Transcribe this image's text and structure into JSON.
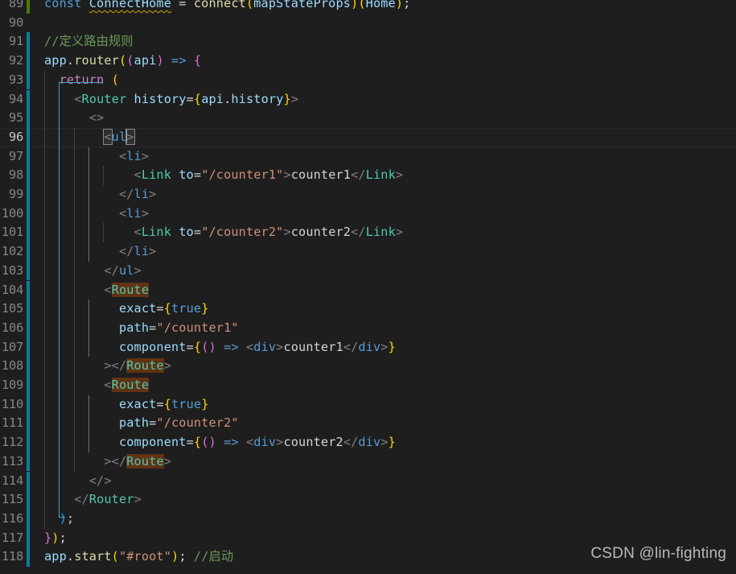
{
  "editor": {
    "theme": "dark-plus",
    "background_color": "#1e1e1e",
    "language": "javascriptreact",
    "first_visible_line": 89,
    "last_visible_line": 118,
    "cursor_line": 96,
    "cursor_column": 10,
    "find_match_term": "Route",
    "find_match_highlight_color": "#613214",
    "git_modified_color": "#0c7d9d",
    "git_added_color": "#487e02",
    "active_indent_guide_color": "#707070",
    "bracket_pair_guide_color": "#4f9dc4"
  },
  "watermark": {
    "text": "CSDN @lin-fighting"
  },
  "lines": [
    {
      "number": "89",
      "git": "add",
      "clipped_top": true,
      "text": "const ConnectHome = connect(mapStateProps)(Home);",
      "tokens": [
        {
          "t": "const ",
          "c": "t-kw2"
        },
        {
          "t": "ConnectHome",
          "c": "t-var squiggle"
        },
        {
          "t": " = ",
          "c": "t-plain"
        },
        {
          "t": "connect",
          "c": "t-fn"
        },
        {
          "t": "(",
          "c": "t-p-y"
        },
        {
          "t": "mapStateProps",
          "c": "t-var"
        },
        {
          "t": ")",
          "c": "t-p-y"
        },
        {
          "t": "(",
          "c": "t-p-y"
        },
        {
          "t": "Home",
          "c": "t-var"
        },
        {
          "t": ")",
          "c": "t-p-y"
        },
        {
          "t": ";",
          "c": "t-plain"
        }
      ]
    },
    {
      "number": "90",
      "git": "none",
      "text": "",
      "tokens": []
    },
    {
      "number": "91",
      "git": "mod",
      "text": "//定义路由规则",
      "tokens": [
        {
          "t": "//定义路由规则",
          "c": "t-comment"
        }
      ]
    },
    {
      "number": "92",
      "git": "mod",
      "text": "app.router((api) => {",
      "tokens": [
        {
          "t": "app",
          "c": "t-var"
        },
        {
          "t": ".",
          "c": "t-plain"
        },
        {
          "t": "router",
          "c": "t-fn"
        },
        {
          "t": "(",
          "c": "t-p-y"
        },
        {
          "t": "(",
          "c": "t-p-m"
        },
        {
          "t": "api",
          "c": "t-var"
        },
        {
          "t": ")",
          "c": "t-p-m"
        },
        {
          "t": " ",
          "c": "t-plain"
        },
        {
          "t": "=>",
          "c": "t-kw2"
        },
        {
          "t": " ",
          "c": "t-plain"
        },
        {
          "t": "{",
          "c": "t-p-m"
        }
      ]
    },
    {
      "number": "93",
      "git": "mod",
      "indent": 1,
      "text": "  return (",
      "tokens": [
        {
          "t": "  ",
          "c": "t-plain"
        },
        {
          "t": "return",
          "c": "t-kw"
        },
        {
          "t": " ",
          "c": "t-plain"
        },
        {
          "t": "(",
          "c": "t-p-y"
        }
      ]
    },
    {
      "number": "94",
      "git": "mod",
      "indent": 1,
      "text": "    <Router history={api.history}>",
      "tokens": [
        {
          "t": "    ",
          "c": "t-plain"
        },
        {
          "t": "<",
          "c": "t-tagb"
        },
        {
          "t": "Router",
          "c": "t-type"
        },
        {
          "t": " ",
          "c": "t-plain"
        },
        {
          "t": "history",
          "c": "t-var"
        },
        {
          "t": "=",
          "c": "t-plain"
        },
        {
          "t": "{",
          "c": "t-p-y"
        },
        {
          "t": "api",
          "c": "t-var"
        },
        {
          "t": ".",
          "c": "t-plain"
        },
        {
          "t": "history",
          "c": "t-var"
        },
        {
          "t": "}",
          "c": "t-p-y"
        },
        {
          "t": ">",
          "c": "t-tagb"
        }
      ]
    },
    {
      "number": "95",
      "git": "mod",
      "indent": 2,
      "text": "      <>",
      "tokens": [
        {
          "t": "      ",
          "c": "t-plain"
        },
        {
          "t": "<>",
          "c": "t-tagb"
        }
      ]
    },
    {
      "number": "96",
      "git": "mod",
      "current": true,
      "indent": 3,
      "text": "        <ul>",
      "tokens": [
        {
          "t": "        ",
          "c": "t-plain"
        },
        {
          "t": "<",
          "c": "t-tagb bmatch"
        },
        {
          "t": "ul",
          "c": "t-kw2"
        },
        {
          "t": "CARET",
          "c": "caret"
        },
        {
          "t": ">",
          "c": "t-tagb bmatch"
        }
      ]
    },
    {
      "number": "97",
      "git": "mod",
      "indent": 4,
      "text": "          <li>",
      "tokens": [
        {
          "t": "          ",
          "c": "t-plain"
        },
        {
          "t": "<",
          "c": "t-tagb"
        },
        {
          "t": "li",
          "c": "t-kw2"
        },
        {
          "t": ">",
          "c": "t-tagb"
        }
      ]
    },
    {
      "number": "98",
      "git": "mod",
      "indent": 5,
      "text": "            <Link to=\"/counter1\">counter1</Link>",
      "tokens": [
        {
          "t": "            ",
          "c": "t-plain"
        },
        {
          "t": "<",
          "c": "t-tagb"
        },
        {
          "t": "Link",
          "c": "t-type"
        },
        {
          "t": " ",
          "c": "t-plain"
        },
        {
          "t": "to",
          "c": "t-var"
        },
        {
          "t": "=",
          "c": "t-plain"
        },
        {
          "t": "\"/counter1\"",
          "c": "t-str"
        },
        {
          "t": ">",
          "c": "t-tagb"
        },
        {
          "t": "counter1",
          "c": "t-plain"
        },
        {
          "t": "</",
          "c": "t-tagb"
        },
        {
          "t": "Link",
          "c": "t-type"
        },
        {
          "t": ">",
          "c": "t-tagb"
        }
      ]
    },
    {
      "number": "99",
      "git": "mod",
      "indent": 4,
      "text": "          </li>",
      "tokens": [
        {
          "t": "          ",
          "c": "t-plain"
        },
        {
          "t": "</",
          "c": "t-tagb"
        },
        {
          "t": "li",
          "c": "t-kw2"
        },
        {
          "t": ">",
          "c": "t-tagb"
        }
      ]
    },
    {
      "number": "100",
      "git": "mod",
      "indent": 4,
      "text": "          <li>",
      "tokens": [
        {
          "t": "          ",
          "c": "t-plain"
        },
        {
          "t": "<",
          "c": "t-tagb"
        },
        {
          "t": "li",
          "c": "t-kw2"
        },
        {
          "t": ">",
          "c": "t-tagb"
        }
      ]
    },
    {
      "number": "101",
      "git": "mod",
      "indent": 5,
      "text": "            <Link to=\"/counter2\">counter2</Link>",
      "tokens": [
        {
          "t": "            ",
          "c": "t-plain"
        },
        {
          "t": "<",
          "c": "t-tagb"
        },
        {
          "t": "Link",
          "c": "t-type"
        },
        {
          "t": " ",
          "c": "t-plain"
        },
        {
          "t": "to",
          "c": "t-var"
        },
        {
          "t": "=",
          "c": "t-plain"
        },
        {
          "t": "\"/counter2\"",
          "c": "t-str"
        },
        {
          "t": ">",
          "c": "t-tagb"
        },
        {
          "t": "counter2",
          "c": "t-plain"
        },
        {
          "t": "</",
          "c": "t-tagb"
        },
        {
          "t": "Link",
          "c": "t-type"
        },
        {
          "t": ">",
          "c": "t-tagb"
        }
      ]
    },
    {
      "number": "102",
      "git": "mod",
      "indent": 4,
      "text": "          </li>",
      "tokens": [
        {
          "t": "          ",
          "c": "t-plain"
        },
        {
          "t": "</",
          "c": "t-tagb"
        },
        {
          "t": "li",
          "c": "t-kw2"
        },
        {
          "t": ">",
          "c": "t-tagb"
        }
      ]
    },
    {
      "number": "103",
      "git": "mod",
      "indent": 3,
      "text": "        </ul>",
      "tokens": [
        {
          "t": "        ",
          "c": "t-plain"
        },
        {
          "t": "</",
          "c": "t-tagb"
        },
        {
          "t": "ul",
          "c": "t-kw2"
        },
        {
          "t": ">",
          "c": "t-tagb"
        }
      ]
    },
    {
      "number": "104",
      "git": "mod",
      "indent": 3,
      "text": "        <Route",
      "tokens": [
        {
          "t": "        ",
          "c": "t-plain"
        },
        {
          "t": "<",
          "c": "t-tagb"
        },
        {
          "t": "Route",
          "c": "t-type hl"
        }
      ]
    },
    {
      "number": "105",
      "git": "mod",
      "indent": 4,
      "text": "          exact={true}",
      "tokens": [
        {
          "t": "          ",
          "c": "t-plain"
        },
        {
          "t": "exact",
          "c": "t-var"
        },
        {
          "t": "=",
          "c": "t-plain"
        },
        {
          "t": "{",
          "c": "t-p-y"
        },
        {
          "t": "true",
          "c": "t-kw2"
        },
        {
          "t": "}",
          "c": "t-p-y"
        }
      ]
    },
    {
      "number": "106",
      "git": "mod",
      "indent": 4,
      "text": "          path=\"/counter1\"",
      "tokens": [
        {
          "t": "          ",
          "c": "t-plain"
        },
        {
          "t": "path",
          "c": "t-var"
        },
        {
          "t": "=",
          "c": "t-plain"
        },
        {
          "t": "\"/counter1\"",
          "c": "t-str"
        }
      ]
    },
    {
      "number": "107",
      "git": "mod",
      "indent": 4,
      "text": "          component={() => <div>counter1</div>}",
      "tokens": [
        {
          "t": "          ",
          "c": "t-plain"
        },
        {
          "t": "component",
          "c": "t-var"
        },
        {
          "t": "=",
          "c": "t-plain"
        },
        {
          "t": "{",
          "c": "t-p-y"
        },
        {
          "t": "(",
          "c": "t-p-m"
        },
        {
          "t": ")",
          "c": "t-p-m"
        },
        {
          "t": " ",
          "c": "t-plain"
        },
        {
          "t": "=>",
          "c": "t-kw2"
        },
        {
          "t": " ",
          "c": "t-plain"
        },
        {
          "t": "<",
          "c": "t-tagb"
        },
        {
          "t": "div",
          "c": "t-kw2"
        },
        {
          "t": ">",
          "c": "t-tagb"
        },
        {
          "t": "counter1",
          "c": "t-plain"
        },
        {
          "t": "</",
          "c": "t-tagb"
        },
        {
          "t": "div",
          "c": "t-kw2"
        },
        {
          "t": ">",
          "c": "t-tagb"
        },
        {
          "t": "}",
          "c": "t-p-y"
        }
      ]
    },
    {
      "number": "108",
      "git": "mod",
      "indent": 3,
      "text": "        ></Route>",
      "tokens": [
        {
          "t": "        ",
          "c": "t-plain"
        },
        {
          "t": "></",
          "c": "t-tagb"
        },
        {
          "t": "Route",
          "c": "t-type hl"
        },
        {
          "t": ">",
          "c": "t-tagb"
        }
      ]
    },
    {
      "number": "109",
      "git": "mod",
      "indent": 3,
      "text": "        <Route",
      "tokens": [
        {
          "t": "        ",
          "c": "t-plain"
        },
        {
          "t": "<",
          "c": "t-tagb"
        },
        {
          "t": "Route",
          "c": "t-type hl"
        }
      ]
    },
    {
      "number": "110",
      "git": "mod",
      "indent": 4,
      "text": "          exact={true}",
      "tokens": [
        {
          "t": "          ",
          "c": "t-plain"
        },
        {
          "t": "exact",
          "c": "t-var"
        },
        {
          "t": "=",
          "c": "t-plain"
        },
        {
          "t": "{",
          "c": "t-p-y"
        },
        {
          "t": "true",
          "c": "t-kw2"
        },
        {
          "t": "}",
          "c": "t-p-y"
        }
      ]
    },
    {
      "number": "111",
      "git": "mod",
      "indent": 4,
      "text": "          path=\"/counter2\"",
      "tokens": [
        {
          "t": "          ",
          "c": "t-plain"
        },
        {
          "t": "path",
          "c": "t-var"
        },
        {
          "t": "=",
          "c": "t-plain"
        },
        {
          "t": "\"/counter2\"",
          "c": "t-str"
        }
      ]
    },
    {
      "number": "112",
      "git": "mod",
      "indent": 4,
      "text": "          component={() => <div>counter2</div>}",
      "tokens": [
        {
          "t": "          ",
          "c": "t-plain"
        },
        {
          "t": "component",
          "c": "t-var"
        },
        {
          "t": "=",
          "c": "t-plain"
        },
        {
          "t": "{",
          "c": "t-p-y"
        },
        {
          "t": "(",
          "c": "t-p-m"
        },
        {
          "t": ")",
          "c": "t-p-m"
        },
        {
          "t": " ",
          "c": "t-plain"
        },
        {
          "t": "=>",
          "c": "t-kw2"
        },
        {
          "t": " ",
          "c": "t-plain"
        },
        {
          "t": "<",
          "c": "t-tagb"
        },
        {
          "t": "div",
          "c": "t-kw2"
        },
        {
          "t": ">",
          "c": "t-tagb"
        },
        {
          "t": "counter2",
          "c": "t-plain"
        },
        {
          "t": "</",
          "c": "t-tagb"
        },
        {
          "t": "div",
          "c": "t-kw2"
        },
        {
          "t": ">",
          "c": "t-tagb"
        },
        {
          "t": "}",
          "c": "t-p-y"
        }
      ]
    },
    {
      "number": "113",
      "git": "mod",
      "indent": 3,
      "text": "        ></Route>",
      "tokens": [
        {
          "t": "        ",
          "c": "t-plain"
        },
        {
          "t": "></",
          "c": "t-tagb"
        },
        {
          "t": "Route",
          "c": "t-type hl"
        },
        {
          "t": ">",
          "c": "t-tagb"
        }
      ]
    },
    {
      "number": "114",
      "git": "mod",
      "indent": 2,
      "text": "      </>",
      "tokens": [
        {
          "t": "      ",
          "c": "t-plain"
        },
        {
          "t": "</>",
          "c": "t-tagb"
        }
      ]
    },
    {
      "number": "115",
      "git": "mod",
      "indent": 1,
      "text": "    </Router>",
      "tokens": [
        {
          "t": "    ",
          "c": "t-plain"
        },
        {
          "t": "</",
          "c": "t-tagb"
        },
        {
          "t": "Router",
          "c": "t-type"
        },
        {
          "t": ">",
          "c": "t-tagb"
        }
      ]
    },
    {
      "number": "116",
      "git": "mod",
      "indent": 1,
      "text": "  );",
      "tokens": [
        {
          "t": "  ",
          "c": "t-plain"
        },
        {
          "t": ")",
          "c": "t-p-b"
        },
        {
          "t": ";",
          "c": "t-plain"
        }
      ]
    },
    {
      "number": "117",
      "git": "mod",
      "text": "});",
      "tokens": [
        {
          "t": "}",
          "c": "t-p-m"
        },
        {
          "t": ")",
          "c": "t-p-y"
        },
        {
          "t": ";",
          "c": "t-plain"
        }
      ]
    },
    {
      "number": "118",
      "git": "mod",
      "text": "app.start(\"#root\"); //启动",
      "tokens": [
        {
          "t": "app",
          "c": "t-var"
        },
        {
          "t": ".",
          "c": "t-plain"
        },
        {
          "t": "start",
          "c": "t-fn"
        },
        {
          "t": "(",
          "c": "t-p-y"
        },
        {
          "t": "\"#root\"",
          "c": "t-str"
        },
        {
          "t": ")",
          "c": "t-p-y"
        },
        {
          "t": "; ",
          "c": "t-plain"
        },
        {
          "t": "//启动",
          "c": "t-comment"
        }
      ]
    }
  ]
}
